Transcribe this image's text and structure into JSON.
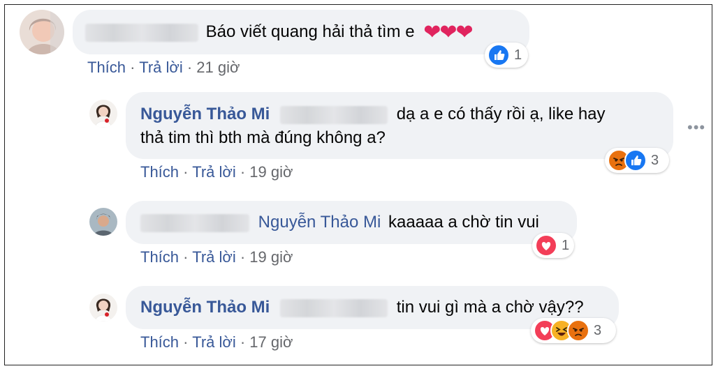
{
  "comments": [
    {
      "author": "",
      "text": "Báo viết quang hải thả tìm e",
      "hearts": "❤❤❤",
      "actions": {
        "like": "Thích",
        "reply": "Trả lời",
        "time": "21 giờ"
      },
      "reaction_count": "1",
      "reactions": [
        "like"
      ]
    },
    {
      "author": "Nguyễn Thảo Mi",
      "text_line1": "dạ a e có thấy rồi ạ, like hay",
      "text_line2": "thả tim thì bth mà đúng không a?",
      "actions": {
        "like": "Thích",
        "reply": "Trả lời",
        "time": "19 giờ"
      },
      "reaction_count": "3",
      "reactions": [
        "angry",
        "like"
      ],
      "more": "•••"
    },
    {
      "mention": "Nguyễn Thảo Mi",
      "text": "kaaaaa a chờ tin vui",
      "actions": {
        "like": "Thích",
        "reply": "Trả lời",
        "time": "19 giờ"
      },
      "reaction_count": "1",
      "reactions": [
        "love"
      ]
    },
    {
      "author": "Nguyễn Thảo Mi",
      "text": "tin vui gì mà a chờ vậy??",
      "actions": {
        "like": "Thích",
        "reply": "Trả lời",
        "time": "17 giờ"
      },
      "reaction_count": "3",
      "reactions": [
        "love",
        "haha",
        "angry"
      ]
    }
  ],
  "colors": {
    "link": "#385898",
    "meta": "#65676b",
    "bubble": "#f0f2f5",
    "like": "#1877f2",
    "love": "#f33e58",
    "angry": "#e9710f",
    "haha": "#f7b125"
  }
}
